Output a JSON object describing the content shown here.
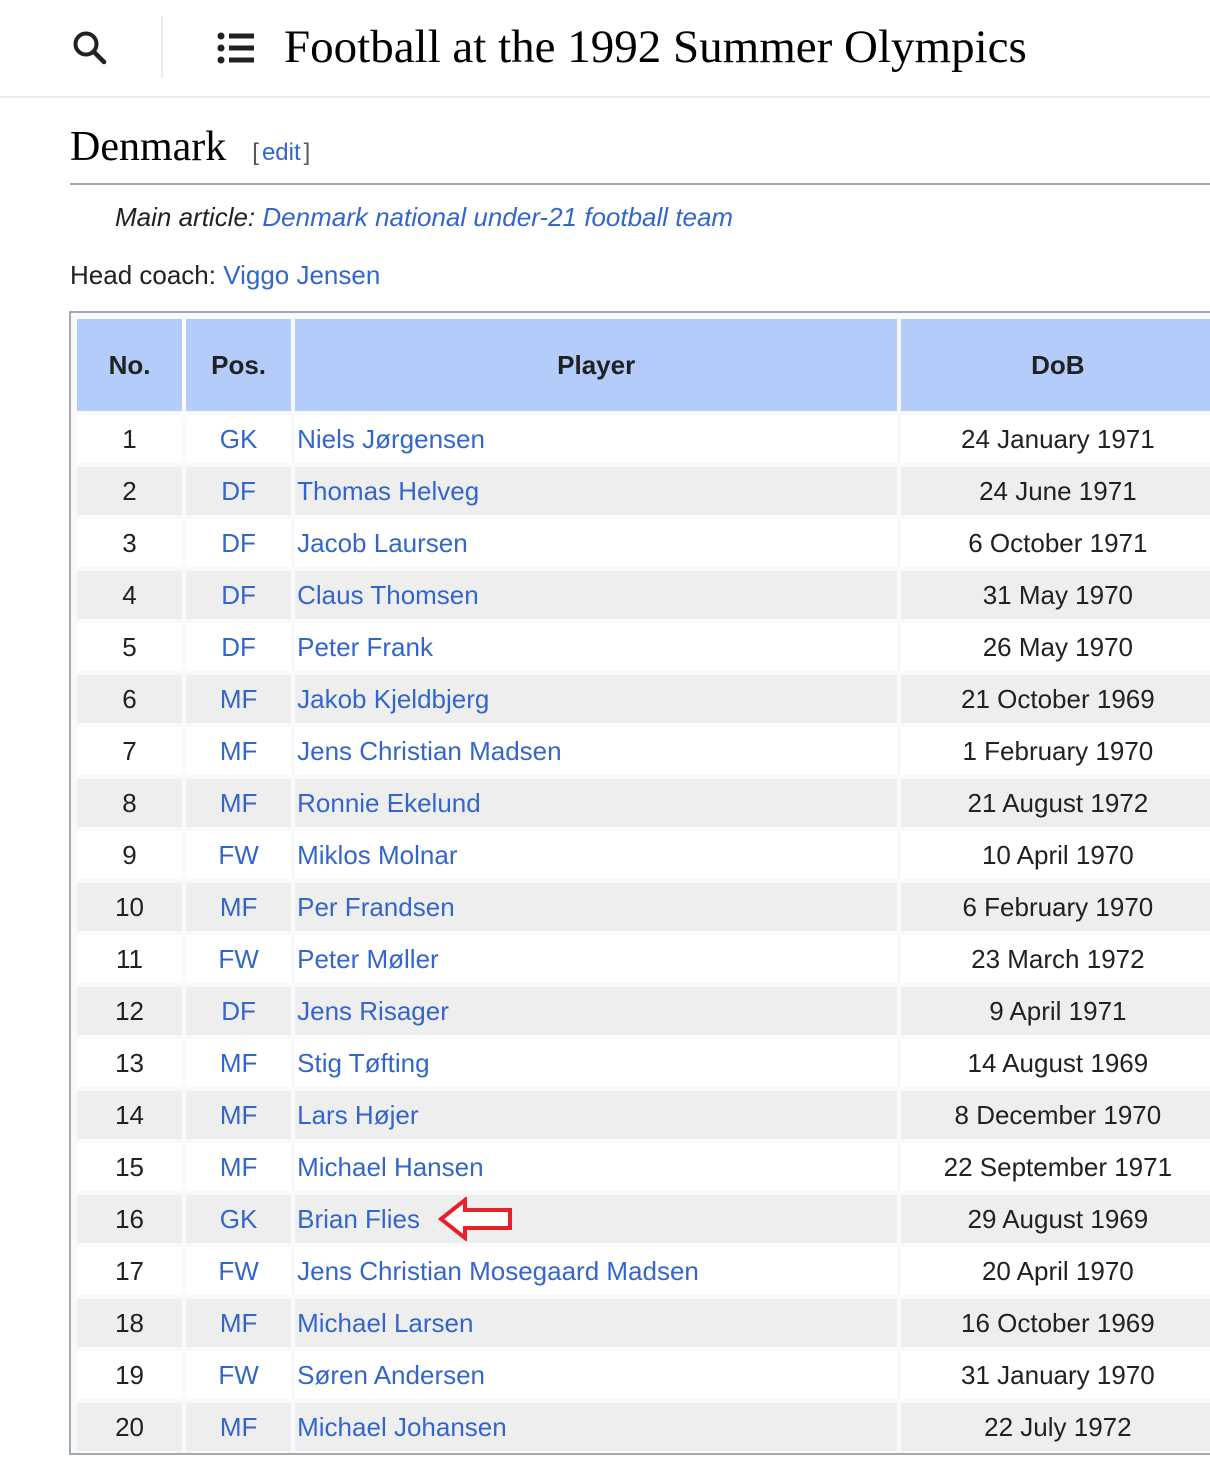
{
  "header": {
    "title": "Football at the 1992 Summer Olympics",
    "search_icon": "search-icon",
    "toc_icon": "list-icon"
  },
  "section": {
    "title": "Denmark",
    "edit_open": "[",
    "edit_label": "edit",
    "edit_close": "]"
  },
  "hatnote": {
    "prefix": "Main article: ",
    "link": "Denmark national under-21 football team"
  },
  "coach": {
    "label": "Head coach: ",
    "name": "Viggo Jensen"
  },
  "table": {
    "headers": {
      "no": "No.",
      "pos": "Pos.",
      "player": "Player",
      "dob": "DoB"
    },
    "rows": [
      {
        "no": "1",
        "pos": "GK",
        "player": "Niels Jørgensen",
        "dob": "24 January 1971"
      },
      {
        "no": "2",
        "pos": "DF",
        "player": "Thomas Helveg",
        "dob": "24 June 1971"
      },
      {
        "no": "3",
        "pos": "DF",
        "player": "Jacob Laursen",
        "dob": "6 October 1971"
      },
      {
        "no": "4",
        "pos": "DF",
        "player": "Claus Thomsen",
        "dob": "31 May 1970"
      },
      {
        "no": "5",
        "pos": "DF",
        "player": "Peter Frank",
        "dob": "26 May 1970"
      },
      {
        "no": "6",
        "pos": "MF",
        "player": "Jakob Kjeldbjerg",
        "dob": "21 October 1969"
      },
      {
        "no": "7",
        "pos": "MF",
        "player": "Jens Christian Madsen",
        "dob": "1 February 1970"
      },
      {
        "no": "8",
        "pos": "MF",
        "player": "Ronnie Ekelund",
        "dob": "21 August 1972"
      },
      {
        "no": "9",
        "pos": "FW",
        "player": "Miklos Molnar",
        "dob": "10 April 1970"
      },
      {
        "no": "10",
        "pos": "MF",
        "player": "Per Frandsen",
        "dob": "6 February 1970"
      },
      {
        "no": "11",
        "pos": "FW",
        "player": "Peter Møller",
        "dob": "23 March 1972"
      },
      {
        "no": "12",
        "pos": "DF",
        "player": "Jens Risager",
        "dob": "9 April 1971"
      },
      {
        "no": "13",
        "pos": "MF",
        "player": "Stig Tøfting",
        "dob": "14 August 1969"
      },
      {
        "no": "14",
        "pos": "MF",
        "player": "Lars Højer",
        "dob": "8 December 1970"
      },
      {
        "no": "15",
        "pos": "MF",
        "player": "Michael Hansen",
        "dob": "22 September 1971"
      },
      {
        "no": "16",
        "pos": "GK",
        "player": "Brian Flies",
        "dob": "29 August 1969",
        "marked": true
      },
      {
        "no": "17",
        "pos": "FW",
        "player": "Jens Christian Mosegaard Madsen",
        "dob": "20 April 1970"
      },
      {
        "no": "18",
        "pos": "MF",
        "player": "Michael Larsen",
        "dob": "16 October 1969"
      },
      {
        "no": "19",
        "pos": "FW",
        "player": "Søren Andersen",
        "dob": "31 January 1970"
      },
      {
        "no": "20",
        "pos": "MF",
        "player": "Michael Johansen",
        "dob": "22 July 1972"
      }
    ]
  },
  "annotation": {
    "icon": "left-arrow-icon",
    "color": "#e8202a"
  },
  "colors": {
    "link": "#3366cc",
    "header_bg": "#b4ccfa",
    "row_alt_bg": "#eeeeee"
  }
}
